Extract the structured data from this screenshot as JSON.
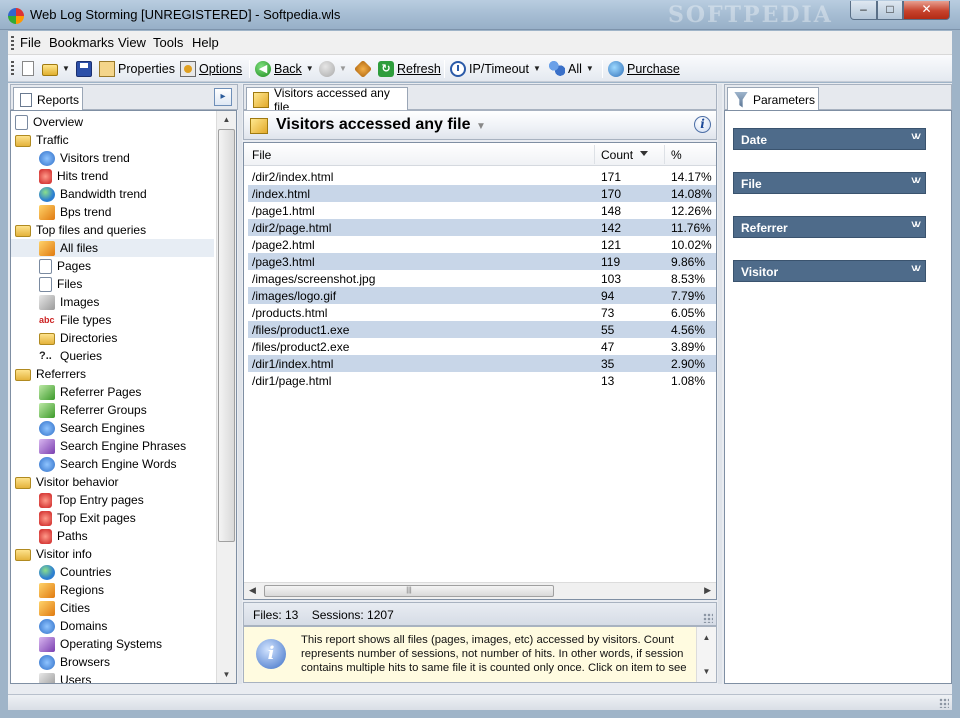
{
  "window": {
    "title": "Web Log Storming  [UNREGISTERED] - Softpedia.wls",
    "watermark": "SOFTPEDIA",
    "controls": {
      "minimize": "–",
      "maximize": "□",
      "close": "✕"
    }
  },
  "menu": [
    "File",
    "Bookmarks",
    "View",
    "Tools",
    "Help"
  ],
  "toolbar": {
    "properties": "Properties",
    "options": "Options",
    "back": "Back",
    "refresh": "Refresh",
    "ip_timeout": "IP/Timeout",
    "all": "All",
    "purchase": "Purchase"
  },
  "reports_panel": {
    "tab_label": "Reports",
    "tree": [
      {
        "label": "Overview",
        "level": 0,
        "icon": "document-icon"
      },
      {
        "label": "Traffic",
        "level": 0,
        "icon": "folder-icon"
      },
      {
        "label": "Visitors trend",
        "level": 1,
        "icon": "visitors-icon"
      },
      {
        "label": "Hits trend",
        "level": 1,
        "icon": "hits-icon"
      },
      {
        "label": "Bandwidth trend",
        "level": 1,
        "icon": "globe-icon"
      },
      {
        "label": "Bps trend",
        "level": 1,
        "icon": "speed-icon"
      },
      {
        "label": "Top files and queries",
        "level": 0,
        "icon": "folder-icon"
      },
      {
        "label": "All files",
        "level": 1,
        "icon": "box-icon",
        "selected": true
      },
      {
        "label": "Pages",
        "level": 1,
        "icon": "page-icon"
      },
      {
        "label": "Files",
        "level": 1,
        "icon": "file-icon"
      },
      {
        "label": "Images",
        "level": 1,
        "icon": "image-icon"
      },
      {
        "label": "File types",
        "level": 1,
        "icon": "abc-icon"
      },
      {
        "label": "Directories",
        "level": 1,
        "icon": "directory-icon"
      },
      {
        "label": "Queries",
        "level": 1,
        "icon": "query-icon"
      },
      {
        "label": "Referrers",
        "level": 0,
        "icon": "folder-icon"
      },
      {
        "label": "Referrer Pages",
        "level": 1,
        "icon": "referrer-page-icon"
      },
      {
        "label": "Referrer Groups",
        "level": 1,
        "icon": "referrer-group-icon"
      },
      {
        "label": "Search Engines",
        "level": 1,
        "icon": "search-engine-icon"
      },
      {
        "label": "Search Engine Phrases",
        "level": 1,
        "icon": "phrases-icon"
      },
      {
        "label": "Search Engine Words",
        "level": 1,
        "icon": "words-icon"
      },
      {
        "label": "Visitor behavior",
        "level": 0,
        "icon": "folder-icon"
      },
      {
        "label": "Top Entry pages",
        "level": 1,
        "icon": "entry-icon"
      },
      {
        "label": "Top Exit pages",
        "level": 1,
        "icon": "exit-icon"
      },
      {
        "label": "Paths",
        "level": 1,
        "icon": "paths-icon"
      },
      {
        "label": "Visitor info",
        "level": 0,
        "icon": "folder-icon"
      },
      {
        "label": "Countries",
        "level": 1,
        "icon": "globe-icon"
      },
      {
        "label": "Regions",
        "level": 1,
        "icon": "regions-icon"
      },
      {
        "label": "Cities",
        "level": 1,
        "icon": "cities-icon"
      },
      {
        "label": "Domains",
        "level": 1,
        "icon": "domains-icon"
      },
      {
        "label": "Operating Systems",
        "level": 1,
        "icon": "windows-icon"
      },
      {
        "label": "Browsers",
        "level": 1,
        "icon": "browser-icon"
      },
      {
        "label": "Users",
        "level": 1,
        "icon": "users-icon"
      }
    ]
  },
  "report": {
    "tab_label": "Visitors accessed any file",
    "title": "Visitors accessed any file",
    "columns": [
      "File",
      "Count",
      "%"
    ],
    "rows": [
      [
        "/dir2/index.html",
        "171",
        "14.17%"
      ],
      [
        "/index.html",
        "170",
        "14.08%"
      ],
      [
        "/page1.html",
        "148",
        "12.26%"
      ],
      [
        "/dir2/page.html",
        "142",
        "11.76%"
      ],
      [
        "/page2.html",
        "121",
        "10.02%"
      ],
      [
        "/page3.html",
        "119",
        "9.86%"
      ],
      [
        "/images/screenshot.jpg",
        "103",
        "8.53%"
      ],
      [
        "/images/logo.gif",
        "94",
        "7.79%"
      ],
      [
        "/products.html",
        "73",
        "6.05%"
      ],
      [
        "/files/product1.exe",
        "55",
        "4.56%"
      ],
      [
        "/files/product2.exe",
        "47",
        "3.89%"
      ],
      [
        "/dir1/index.html",
        "35",
        "2.90%"
      ],
      [
        "/dir1/page.html",
        "13",
        "1.08%"
      ]
    ],
    "status": "Files: 13    Sessions: 1207",
    "help_text": "This report shows all files (pages, images, etc) accessed by visitors. Count represents number of sessions, not number of hits. In other words, if session contains multiple hits to same file it is counted only once. Click on item to see"
  },
  "parameters_panel": {
    "tab_label": "Parameters",
    "items": [
      "Date",
      "File",
      "Referrer",
      "Visitor"
    ]
  },
  "colors": {
    "row_alt": "#c8d6e8",
    "param_header": "#4e6b8a",
    "help_background": "#fffbe0"
  }
}
